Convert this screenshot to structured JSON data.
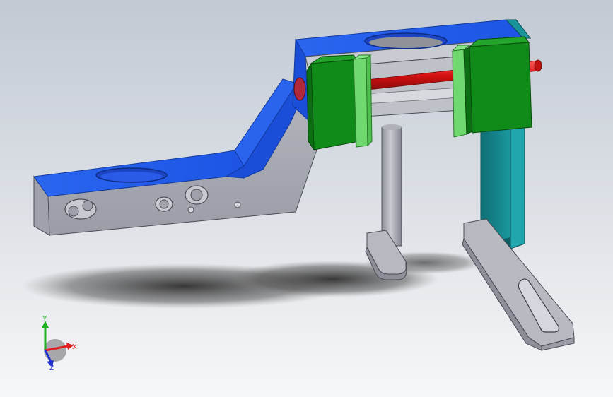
{
  "viewport": {
    "background_top": "#c2c9d3",
    "background_bottom": "#f6f7f8"
  },
  "model": {
    "colors": {
      "blue_face": "#1f57e6",
      "blue_dark": "#163fb0",
      "gray_face": "#a7a9b3",
      "gray_light": "#c3c5cd",
      "green_block": "#118a18",
      "green_light": "#6fd86f",
      "red_rod": "#e01515",
      "teal_post": "#137f85",
      "shadow": "#3a3a3a"
    }
  },
  "triad": {
    "x_label": "X",
    "y_label": "Y",
    "z_label": "Z",
    "x_color": "#e02020",
    "y_color": "#20b020",
    "z_color": "#2030d0"
  }
}
